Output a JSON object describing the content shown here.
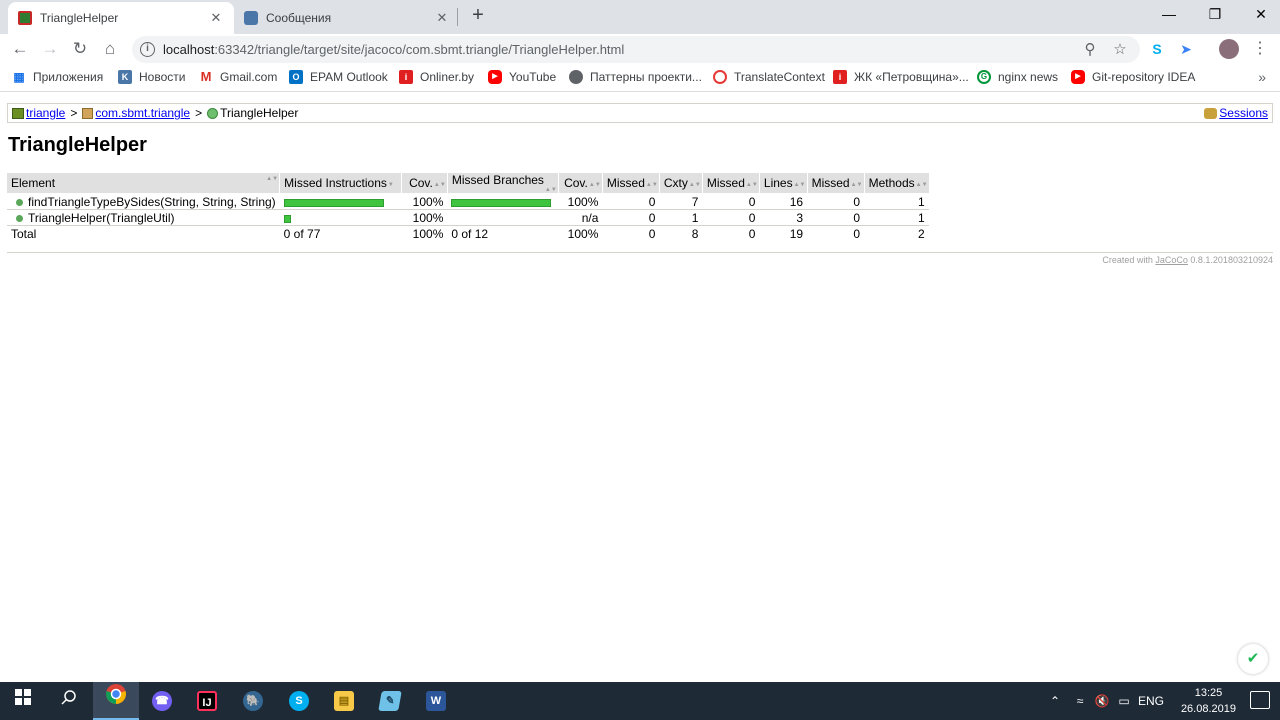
{
  "browser": {
    "tabs": [
      {
        "title": "TriangleHelper",
        "active": true,
        "close": "✕"
      },
      {
        "title": "Сообщения",
        "active": false,
        "close": "✕"
      }
    ],
    "new_tab": "+",
    "window_controls": {
      "minimize": "—",
      "maximize": "❐",
      "close": "✕"
    },
    "url_host": "localhost",
    "url_rest": ":63342/triangle/target/site/jacoco/com.sbmt.triangle/TriangleHelper.html",
    "bookmarks": [
      {
        "label": "Приложения",
        "icon": "apps-grid-icon"
      },
      {
        "label": "Новости",
        "icon": "vk-icon"
      },
      {
        "label": "Gmail.com",
        "icon": "gmail-icon"
      },
      {
        "label": "EPAM Outlook",
        "icon": "outlook-icon"
      },
      {
        "label": "Onliner.by",
        "icon": "onliner-icon"
      },
      {
        "label": "YouTube",
        "icon": "youtube-icon"
      },
      {
        "label": "Паттерны проекти...",
        "icon": "globe-icon"
      },
      {
        "label": "TranslateContext",
        "icon": "translatecontext-icon"
      },
      {
        "label": "ЖК «Петровщина»...",
        "icon": "onliner-icon"
      },
      {
        "label": "nginx news",
        "icon": "nginx-icon"
      },
      {
        "label": "Git-repository IDEA",
        "icon": "youtube-icon"
      }
    ],
    "bookmarks_more": "»"
  },
  "report": {
    "breadcrumb": {
      "project": "triangle",
      "package": "com.sbmt.triangle",
      "class": "TriangleHelper",
      "separator": ">"
    },
    "sessions_label": "Sessions",
    "title": "TriangleHelper",
    "columns": [
      "Element",
      "Missed Instructions",
      "Cov.",
      "Missed Branches",
      "Cov.",
      "Missed",
      "Cxty",
      "Missed",
      "Lines",
      "Missed",
      "Methods"
    ],
    "rows": [
      {
        "element": "findTriangleTypeBySides(String, String, String)",
        "instr_cov_fraction": 1.0,
        "instr_bar_fraction": 1.0,
        "instr_cov": "100%",
        "branch_bar_fraction": 1.0,
        "branch_cov": "100%",
        "missed_cxty": "0",
        "cxty": "7",
        "missed_lines": "0",
        "lines": "16",
        "missed_methods": "0",
        "methods": "1"
      },
      {
        "element": "TriangleHelper(TriangleUtil)",
        "instr_cov_fraction": 1.0,
        "instr_bar_fraction": 0.07,
        "instr_cov": "100%",
        "branch_bar_fraction": 0,
        "branch_cov": "n/a",
        "missed_cxty": "0",
        "cxty": "1",
        "missed_lines": "0",
        "lines": "3",
        "missed_methods": "0",
        "methods": "1"
      }
    ],
    "total": {
      "label": "Total",
      "instr": "0 of 77",
      "instr_cov": "100%",
      "branch": "0 of 12",
      "branch_cov": "100%",
      "missed_cxty": "0",
      "cxty": "8",
      "missed_lines": "0",
      "lines": "19",
      "missed_methods": "0",
      "methods": "2"
    },
    "footer_prefix": "Created with",
    "footer_link": "JaCoCo",
    "footer_version": "0.8.1.201803210924"
  },
  "taskbar": {
    "apps": [
      "windows-start-icon",
      "search-icon",
      "chrome-icon",
      "viber-icon",
      "intellij-icon",
      "pgadmin-icon",
      "skype-icon",
      "file-explorer-icon",
      "notepad-icon",
      "word-icon"
    ],
    "language": "ENG",
    "time": "13:25",
    "date": "26.08.2019"
  },
  "colors": {
    "coverage_bar": "#3ec43e",
    "table_header": "#e0e0e0",
    "taskbar": "#1e2a36"
  }
}
